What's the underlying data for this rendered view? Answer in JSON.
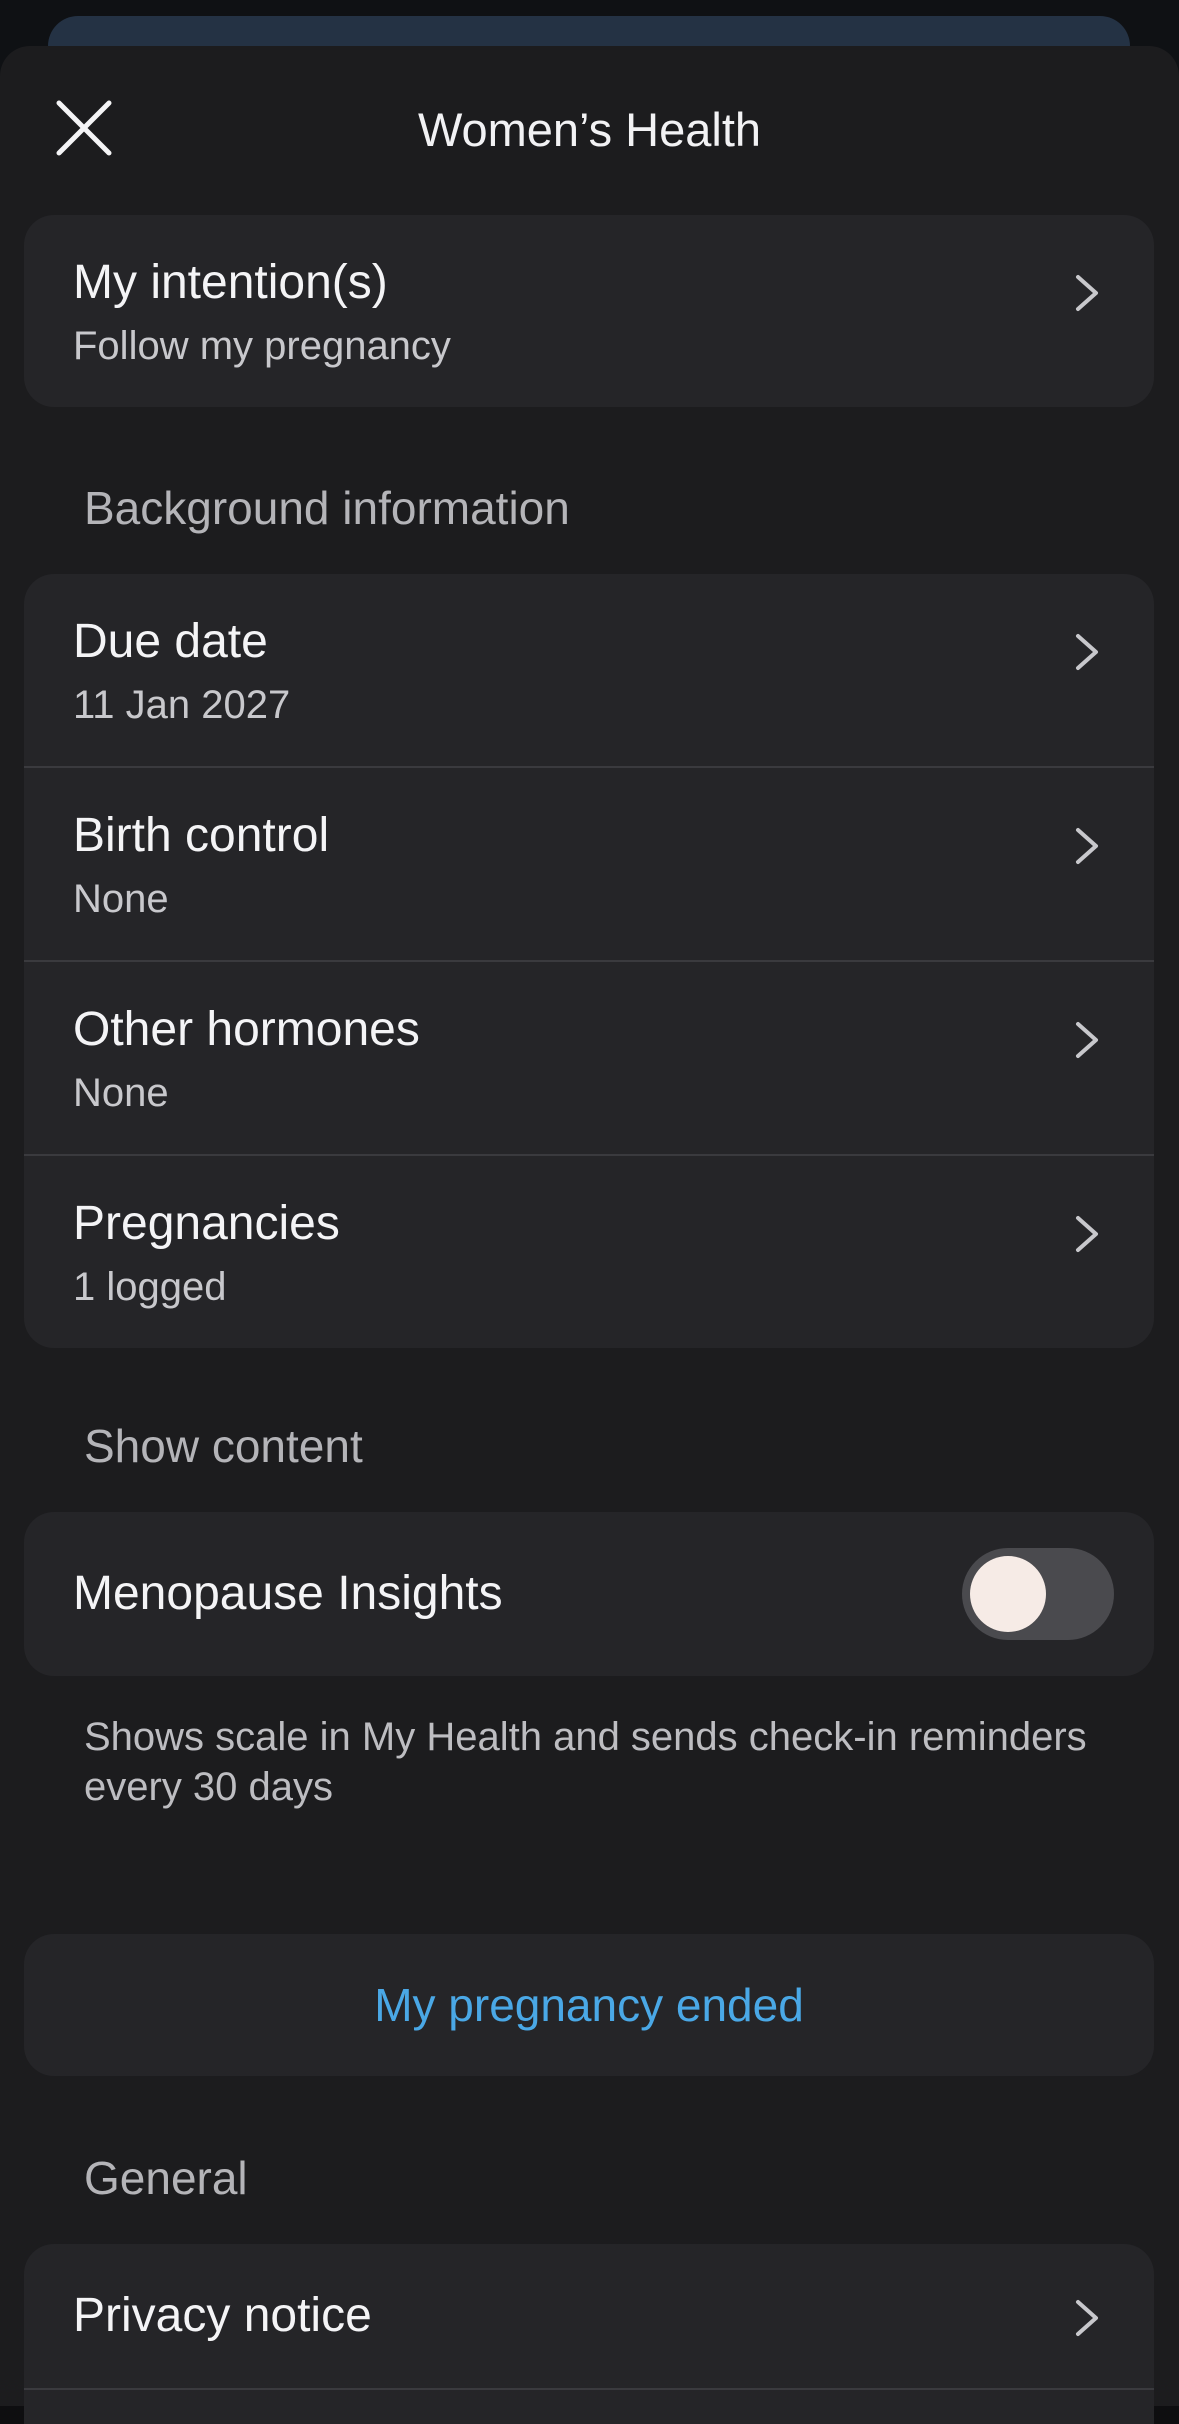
{
  "header": {
    "title": "Women’s Health"
  },
  "intention": {
    "title": "My intention(s)",
    "value": "Follow my pregnancy"
  },
  "background": {
    "section_label": "Background information",
    "items": [
      {
        "title": "Due date",
        "value": "11 Jan 2027"
      },
      {
        "title": "Birth control",
        "value": "None"
      },
      {
        "title": "Other hormones",
        "value": "None"
      },
      {
        "title": "Pregnancies",
        "value": "1 logged"
      }
    ]
  },
  "content": {
    "section_label": "Show content",
    "toggle_label": "Menopause Insights",
    "toggle_on": false,
    "footnote": "Shows scale in My Health and sends check-in reminders every 30 days"
  },
  "pregnancy_action": {
    "label": "My pregnancy ended"
  },
  "general": {
    "section_label": "General",
    "items": [
      {
        "title": "Privacy notice"
      }
    ]
  },
  "colors": {
    "background": "#1c1c1e",
    "card": "#252528",
    "accent_link": "#4aa8e6",
    "toggle_knob": "#f6ebe6"
  },
  "icons": {
    "close": "close-icon",
    "chevron": "chevron-right-icon"
  }
}
